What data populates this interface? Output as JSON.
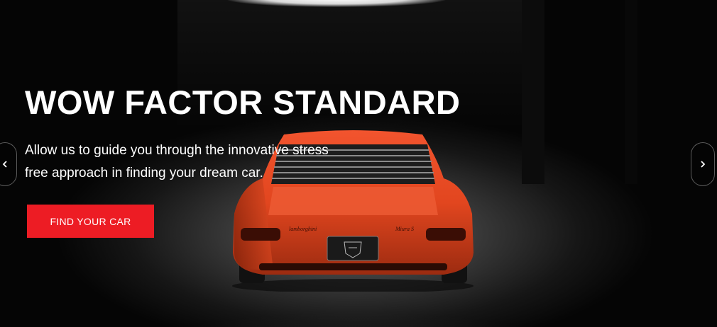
{
  "hero": {
    "title": "WOW FACTOR STANDARD",
    "subtitle": "Allow us to guide you through the innovative stress free approach in finding your dream car.",
    "cta_label": "FIND YOUR CAR",
    "cta_color": "#ed1c24",
    "background_image": "orange sports car rear view in dark studio"
  },
  "carousel": {
    "prev_icon": "chevron-left-icon",
    "next_icon": "chevron-right-icon"
  },
  "car_badges": {
    "left_script": "lamborghini",
    "right_script": "Miura S",
    "plate": "lamborghini"
  }
}
